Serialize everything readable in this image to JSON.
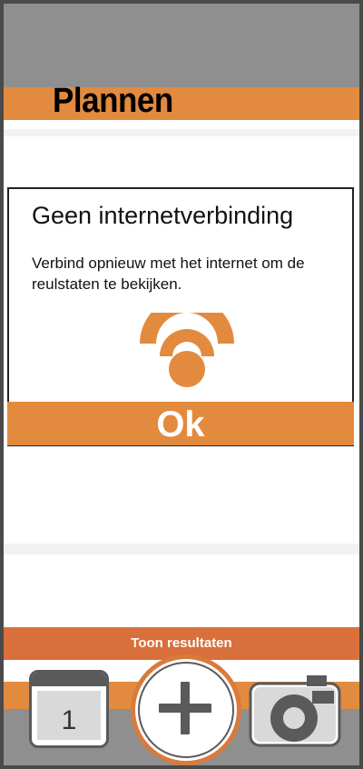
{
  "header": {
    "title": "Plannen"
  },
  "dialog": {
    "title": "Geen internetverbinding",
    "message": "Verbind opnieuw met het internet om de reulstaten te bekijken.",
    "icon": "wifi-icon",
    "ok_label": "Ok"
  },
  "actions": {
    "results_label": "Toon resultaten"
  },
  "bottom_nav": {
    "calendar_day": "1",
    "calendar_icon": "calendar-icon",
    "add_icon": "plus-icon",
    "camera_icon": "camera-icon"
  },
  "colors": {
    "accent": "#e28a3e",
    "results": "#d96f3b",
    "gray": "#8e8f8e",
    "icon_gray": "#5a5a5a"
  }
}
